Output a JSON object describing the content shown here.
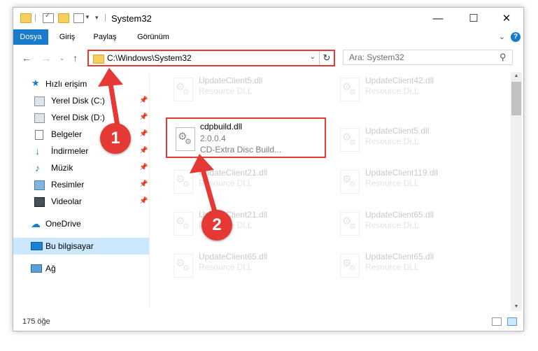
{
  "window": {
    "title": "System32",
    "controls": {
      "minimize": "—",
      "maximize": "☐",
      "close": "✕"
    }
  },
  "ribbon": {
    "tabs": [
      "Dosya",
      "Giriş",
      "Paylaş",
      "Görünüm"
    ],
    "help": "?"
  },
  "nav": {
    "address": "C:\\Windows\\System32",
    "search_placeholder": "Ara: System32"
  },
  "sidebar": {
    "quick_access": "Hızlı erişim",
    "pinned": [
      {
        "label": "Yerel Disk (C:)",
        "icon": "drive-icon"
      },
      {
        "label": "Yerel Disk (D:)",
        "icon": "drive-icon"
      },
      {
        "label": "Belgeler",
        "icon": "documents-icon"
      },
      {
        "label": "İndirmeler",
        "icon": "downloads-icon"
      },
      {
        "label": "Müzik",
        "icon": "music-icon"
      },
      {
        "label": "Resimler",
        "icon": "pictures-icon"
      },
      {
        "label": "Videolar",
        "icon": "videos-icon"
      }
    ],
    "onedrive": "OneDrive",
    "this_pc": "Bu bilgisayar",
    "network": "Ağ"
  },
  "files": {
    "left": [
      {
        "name": "UpdateClient5.dll",
        "desc": "Resource DLL"
      },
      {
        "name": "cdpbuild.dll",
        "version": "2.0.0.4",
        "desc": "CD-Extra Disc Build..."
      },
      {
        "name": "UpdateClient21.dll",
        "desc": "Resource DLL"
      },
      {
        "name": "UpdateClient21.dll",
        "desc": "Resource DLL"
      },
      {
        "name": "UpdateClient65.dll",
        "desc": "Resource DLL"
      }
    ],
    "right": [
      {
        "name": "UpdateClient42.dll",
        "desc": "Resource DLL"
      },
      {
        "name": "UpdateClient5.dll",
        "desc": "Resource DLL"
      },
      {
        "name": "UpdateClient119.dll",
        "desc": "Resource DLL"
      },
      {
        "name": "UpdateClient65.dll",
        "desc": "Resource DLL"
      },
      {
        "name": "UpdateClient65.dll",
        "desc": "Resource DLL"
      }
    ]
  },
  "status": {
    "count": "175 öğe"
  },
  "annotations": {
    "step1": "1",
    "step2": "2",
    "color": "#e53935"
  }
}
